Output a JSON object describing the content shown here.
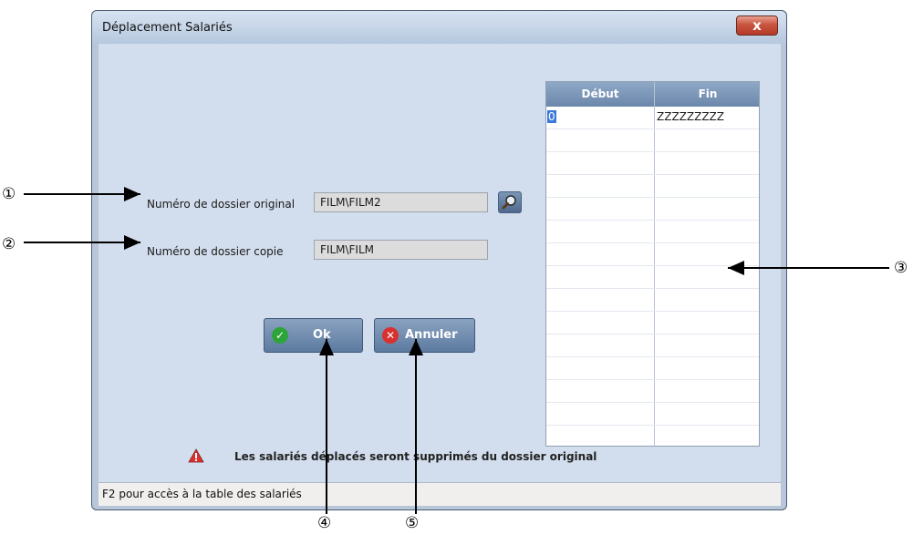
{
  "window": {
    "title": "Déplacement Salariés",
    "close_label": "x"
  },
  "fields": {
    "original_label": "Numéro de dossier original",
    "original_value": "FILM\\FILM2",
    "copy_label": "Numéro de dossier copie",
    "copy_value": "FILM\\FILM"
  },
  "buttons": {
    "ok_label": "Ok",
    "cancel_label": "Annuler"
  },
  "grid": {
    "columns": [
      "Début",
      "Fin"
    ],
    "rows": [
      {
        "debut": "0",
        "fin": "ZZZZZZZZZ"
      }
    ]
  },
  "warning": "Les salariés déplacés seront supprimés du dossier original",
  "status_bar": "F2 pour accès à la table des salariés",
  "callouts": {
    "c1": "①",
    "c2": "②",
    "c3": "③",
    "c4": "④",
    "c5": "⑤"
  },
  "colors": {
    "window_bg": "#d2dded",
    "button": "#5c7aa0",
    "ok_icon": "#2ca43a",
    "cancel_icon": "#d8312f",
    "warning_icon": "#d8312f"
  }
}
